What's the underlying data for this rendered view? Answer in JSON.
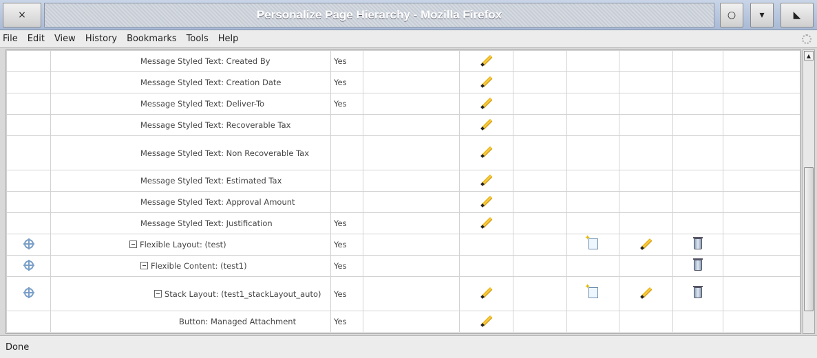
{
  "window": {
    "title": "Personalize Page Hierarchy - Mozilla Firefox",
    "close_glyph": "×",
    "min_glyph": "○",
    "max_glyph": "▾",
    "restore_glyph": "◣"
  },
  "menu": [
    "File",
    "Edit",
    "View",
    "History",
    "Bookmarks",
    "Tools",
    "Help"
  ],
  "rows": [
    {
      "name": "Message Styled Text: Created By",
      "visible": "Yes",
      "indent": 130,
      "select": false,
      "update": true,
      "create": false,
      "update2": false,
      "delete": false,
      "collapsible": false
    },
    {
      "name": "Message Styled Text: Creation Date",
      "visible": "Yes",
      "indent": 130,
      "select": false,
      "update": true,
      "create": false,
      "update2": false,
      "delete": false,
      "collapsible": false
    },
    {
      "name": "Message Styled Text: Deliver-To",
      "visible": "Yes",
      "indent": 130,
      "select": false,
      "update": true,
      "create": false,
      "update2": false,
      "delete": false,
      "collapsible": false
    },
    {
      "name": "Message Styled Text: Recoverable Tax",
      "visible": "",
      "indent": 130,
      "select": false,
      "update": true,
      "create": false,
      "update2": false,
      "delete": false,
      "collapsible": false
    },
    {
      "name": "Message Styled Text: Non Recoverable Tax",
      "visible": "",
      "indent": 130,
      "select": false,
      "update": true,
      "create": false,
      "update2": false,
      "delete": false,
      "collapsible": false,
      "tall": true
    },
    {
      "name": "Message Styled Text: Estimated Tax",
      "visible": "",
      "indent": 130,
      "select": false,
      "update": true,
      "create": false,
      "update2": false,
      "delete": false,
      "collapsible": false
    },
    {
      "name": "Message Styled Text: Approval Amount",
      "visible": "",
      "indent": 130,
      "select": false,
      "update": true,
      "create": false,
      "update2": false,
      "delete": false,
      "collapsible": false
    },
    {
      "name": "Message Styled Text: Justification",
      "visible": "Yes",
      "indent": 130,
      "select": false,
      "update": true,
      "create": false,
      "update2": false,
      "delete": false,
      "collapsible": false
    },
    {
      "name": "Flexible Layout: (test)",
      "visible": "Yes",
      "indent": 114,
      "select": true,
      "update": false,
      "create": true,
      "update2": true,
      "delete": true,
      "collapsible": true
    },
    {
      "name": "Flexible Content: (test1)",
      "visible": "Yes",
      "indent": 130,
      "select": true,
      "update": false,
      "create": false,
      "update2": false,
      "delete": true,
      "collapsible": true
    },
    {
      "name": "Stack Layout: (test1_stackLayout_auto)",
      "visible": "Yes",
      "indent": 150,
      "select": true,
      "update": true,
      "create": true,
      "update2": true,
      "delete": true,
      "collapsible": true,
      "tall": true
    },
    {
      "name": "Button: Managed Attachment",
      "visible": "Yes",
      "indent": 186,
      "select": false,
      "update": true,
      "create": false,
      "update2": false,
      "delete": false,
      "collapsible": false
    }
  ],
  "status": "Done"
}
